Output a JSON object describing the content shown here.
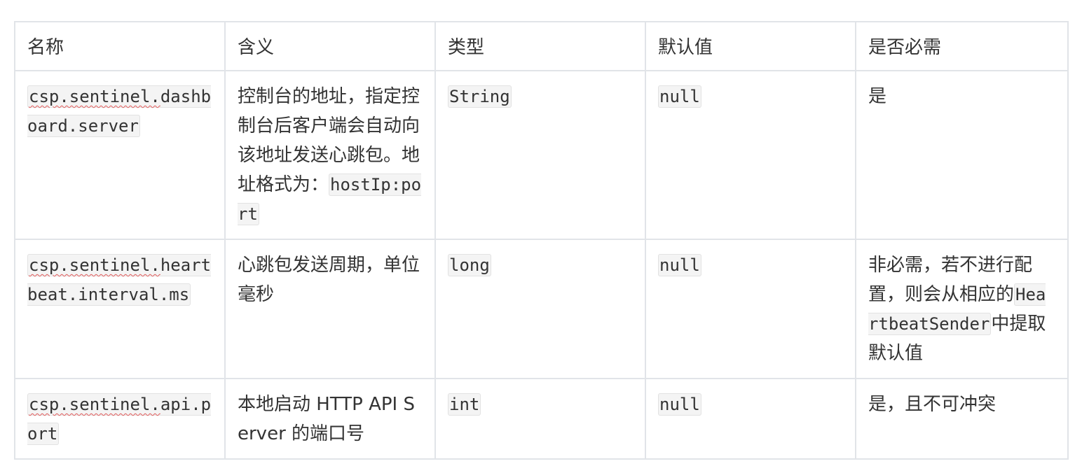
{
  "table": {
    "headers": [
      "名称",
      "含义",
      "类型",
      "默认值",
      "是否必需"
    ],
    "rows": [
      {
        "name_prefix": "csp.sentinel.",
        "name_rest": "dashboard.server",
        "meaning": "控制台的地址，指定控制台后客户端会自动向该地址发送心跳包。地址格式为：",
        "meaning_code": "hostIp:port",
        "type": "String",
        "default": "null",
        "required": "是",
        "required_code": "",
        "required_suffix": ""
      },
      {
        "name_prefix": "csp.sentinel.",
        "name_rest": "heartbeat.interval.ms",
        "meaning": "心跳包发送周期，单位毫秒",
        "meaning_code": "",
        "type": "long",
        "default": "null",
        "required": "非必需，若不进行配置，则会从相应的",
        "required_code": "HeartbeatSender",
        "required_suffix": "中提取默认值"
      },
      {
        "name_prefix": "csp.sentinel.",
        "name_rest": "api.port",
        "meaning": "本地启动 HTTP API Server 的端口号",
        "meaning_code": "",
        "type": "int",
        "default": "null",
        "required": "是，且不可冲突",
        "required_code": "",
        "required_suffix": ""
      }
    ]
  }
}
